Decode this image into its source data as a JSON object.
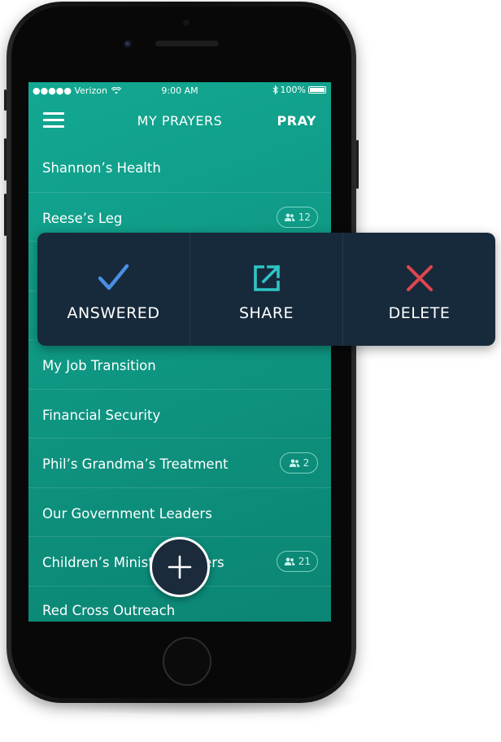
{
  "status_bar": {
    "carrier": "●●●●● Verizon",
    "time": "9:00 AM",
    "battery_text": "100%"
  },
  "nav": {
    "title": "MY PRAYERS",
    "action_label": "PRAY"
  },
  "prayers": [
    {
      "title": "Shannon’s Health",
      "group_count": null
    },
    {
      "title": "Reese’s Leg",
      "group_count": "12"
    },
    {
      "title": "My Job Transition",
      "group_count": null
    },
    {
      "title": "Financial Security",
      "group_count": null
    },
    {
      "title": "Phil’s Grandma’s Treatment",
      "group_count": "2"
    },
    {
      "title": "Our Government Leaders",
      "group_count": null
    },
    {
      "title": "Children’s Ministry Leaders",
      "group_count": "21"
    },
    {
      "title": "Red Cross Outreach",
      "group_count": null
    }
  ],
  "actions": {
    "answered": "ANSWERED",
    "share": "SHARE",
    "delete": "DELETE"
  },
  "colors": {
    "screen_bg": "#119e8a",
    "popup_bg": "#172a3b",
    "answered_icon": "#4a90e2",
    "share_icon": "#2ec5c5",
    "delete_icon": "#e0464f"
  },
  "icons": {
    "menu": "hamburger-icon",
    "add": "plus-icon",
    "group": "people-icon",
    "answered": "checkmark-icon",
    "share": "external-link-icon",
    "delete": "close-x-icon"
  }
}
